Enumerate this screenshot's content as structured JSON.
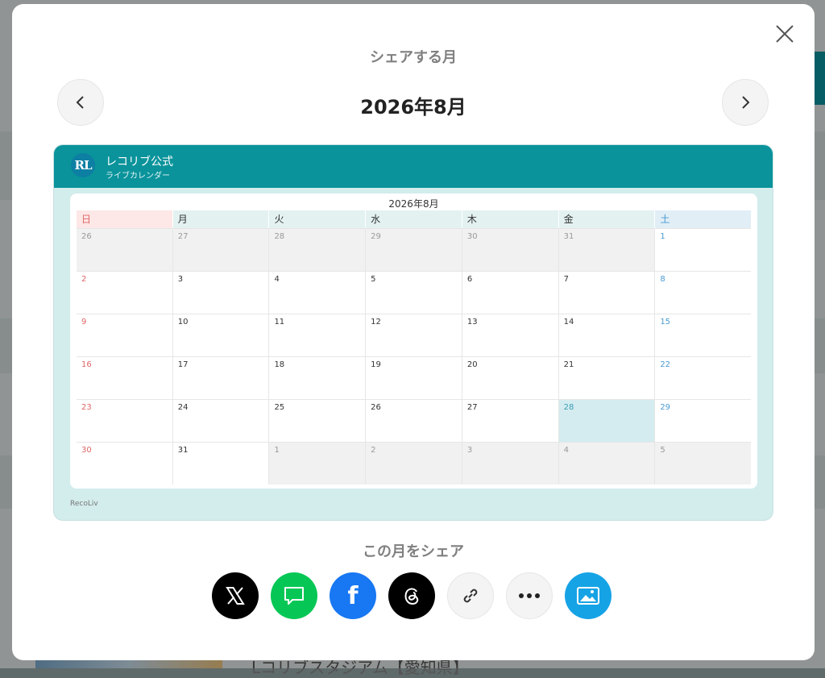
{
  "modal": {
    "subtitle": "シェアする月",
    "month_title": "2026年8月"
  },
  "card": {
    "brand_logo": "RL",
    "brand_name": "レコリブ公式",
    "brand_sub": "ライブカレンダー",
    "calendar_title": "2026年8月",
    "footer": "RecoLiv",
    "weekdays": [
      "日",
      "月",
      "火",
      "水",
      "木",
      "金",
      "土"
    ],
    "weeks": [
      [
        "26",
        "27",
        "28",
        "29",
        "30",
        "31",
        "1"
      ],
      [
        "2",
        "3",
        "4",
        "5",
        "6",
        "7",
        "8"
      ],
      [
        "9",
        "10",
        "11",
        "12",
        "13",
        "14",
        "15"
      ],
      [
        "16",
        "17",
        "18",
        "19",
        "20",
        "21",
        "22"
      ],
      [
        "23",
        "24",
        "25",
        "26",
        "27",
        "28",
        "29"
      ],
      [
        "30",
        "31",
        "1",
        "2",
        "3",
        "4",
        "5"
      ]
    ]
  },
  "share": {
    "label": "この月をシェア",
    "buttons": [
      "x-icon",
      "line-icon",
      "facebook-icon",
      "threads-icon",
      "link-icon",
      "more-icon",
      "image-icon"
    ]
  },
  "background": {
    "bottom_text": "Lコリブスタジアム【愛知県】"
  },
  "colors": {
    "teal": "#0a939b",
    "sunday": "#e06565",
    "saturday": "#4b9ad1",
    "today_bg": "#d4ecf0"
  }
}
